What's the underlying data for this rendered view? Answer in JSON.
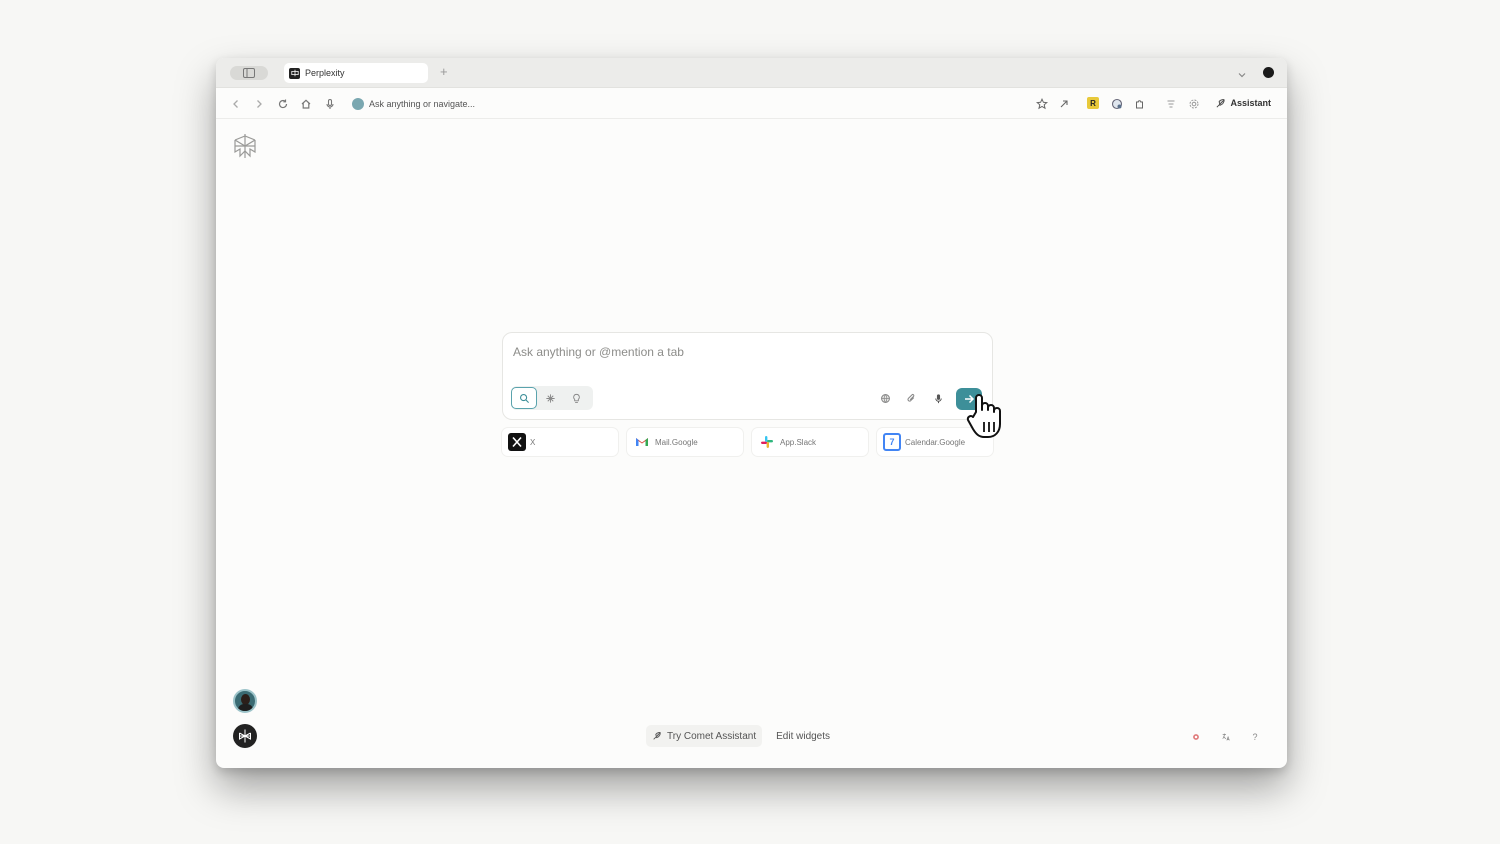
{
  "tabbar": {
    "tabs": [
      {
        "title": "Perplexity",
        "icon": "perplexity-favicon"
      }
    ],
    "new_tab_label": "+"
  },
  "toolbar": {
    "omnibox_placeholder": "Ask anything or navigate...",
    "extension_r_label": "R",
    "assistant_label": "Assistant"
  },
  "search": {
    "placeholder": "Ask anything or @mention a tab",
    "value": "",
    "modes": [
      "search-icon",
      "research-icon",
      "labs-icon"
    ],
    "active_mode": "search"
  },
  "shortcuts": [
    {
      "label": "X",
      "icon": "x-logo-icon"
    },
    {
      "label": "Mail.Google",
      "icon": "gmail-icon"
    },
    {
      "label": "App.Slack",
      "icon": "slack-icon"
    },
    {
      "label": "Calendar.Google",
      "icon": "google-calendar-icon",
      "icon_text": "7"
    }
  ],
  "bottom_bar": {
    "try_assistant_label": "Try Comet Assistant",
    "edit_widgets_label": "Edit widgets",
    "help_label": "?"
  },
  "colors": {
    "accent": "#3d8f99",
    "background": "#fcfcfb"
  }
}
